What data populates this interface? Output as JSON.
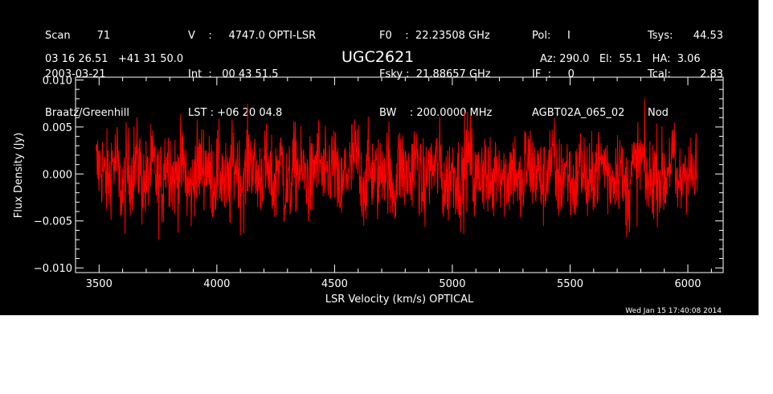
{
  "header": {
    "col1": [
      "Scan        71",
      "2003-03-21",
      "Braatz/Greenhill"
    ],
    "col2": [
      "V    :     4747.0 OPTI-LSR",
      "Int  :   00 43 51.5",
      "LST : +06 20 04.8"
    ],
    "col3": [
      "F0    :  22.23508 GHz",
      "Fsky :  21.88657 GHz",
      "BW    : 200.0000 MHz"
    ],
    "col4": [
      "Pol:     I",
      "IF  :     0",
      "AGBT02A_065_02"
    ],
    "col5": [
      "Tsys:",
      "Tcal:",
      "Nod"
    ],
    "col6": [
      "44.53",
      "2.83",
      ""
    ],
    "coords": "03 16 26.51   +41 31 50.0",
    "source": "UGC2621",
    "pointing": "Az: 290.0   El:  55.1   HA:  3.06",
    "timestamp": "Wed Jan 15 17:40:08 2014"
  },
  "colors": {
    "background": "#000000",
    "foreground": "#ffffff",
    "trace": "#ff0000"
  },
  "chart_data": {
    "type": "line",
    "xlabel": "LSR Velocity (km/s) OPTICAL",
    "ylabel": "Flux Density (Jy)",
    "xlim": [
      3400,
      6150
    ],
    "ylim": [
      -0.0105,
      0.0103
    ],
    "xticks": [
      3500,
      4000,
      4500,
      5000,
      5500,
      6000
    ],
    "xticklabels": [
      "3500",
      "4000",
      "4500",
      "5000",
      "5500",
      "6000"
    ],
    "yticks": [
      -0.01,
      -0.005,
      0.0,
      0.005,
      0.01
    ],
    "yticklabels": [
      "−0.010",
      "−0.005",
      "0.000",
      "0.005",
      "0.010"
    ],
    "series": [
      {
        "x_start": 3487,
        "x_end": 6040,
        "noise_rms": 0.0023,
        "mean": 0.0,
        "values": [
          0.0021,
          -0.0012,
          0.0034,
          -0.0041,
          0.0008,
          0.0029,
          -0.0026,
          0.0015,
          -0.0033,
          0.0041,
          -0.0007,
          0.0019,
          -0.0048,
          0.0022,
          0.0031,
          -0.0014,
          0.0006,
          -0.0039,
          0.0027,
          -0.0021,
          0.0044,
          -0.0009,
          0.0012,
          -0.0031,
          0.0036,
          -0.0045,
          0.0018,
          0.0003,
          -0.0024,
          0.0039,
          -0.0016,
          0.0025,
          -0.0052,
          0.0011,
          0.0046,
          -0.0028,
          0.0009,
          -0.0013,
          0.0032,
          -0.0037,
          0.0023,
          -0.0005,
          0.0038,
          -0.0042,
          0.0014,
          0.0027,
          -0.003,
          0.0007,
          -0.0019,
          0.0049,
          -0.0023,
          0.0016,
          -0.0035,
          0.003,
          -0.0008,
          0.002,
          -0.0046,
          0.0035,
          0.0002,
          -0.0027,
          0.0042,
          -0.0018,
          0.001,
          -0.0034,
          0.0026,
          -0.004,
          0.0017,
          0.0033,
          -0.0011,
          0.0024,
          -0.0049,
          0.0013,
          0.0037,
          -0.0025,
          0.0005,
          -0.0015,
          0.0045,
          -0.0032,
          0.0021,
          -0.0006
        ]
      }
    ]
  }
}
